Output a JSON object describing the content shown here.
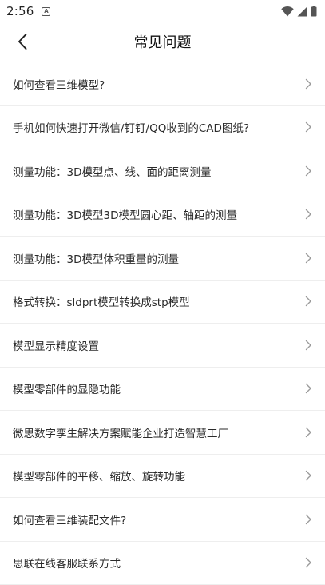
{
  "status_bar": {
    "time": "2:56",
    "notification_letter": "A",
    "icons": [
      "wifi-icon",
      "signal-icon",
      "battery-icon"
    ]
  },
  "header": {
    "title": "常见问题",
    "back_icon": "chevron-left-icon"
  },
  "faq": {
    "items": [
      {
        "label": "如何查看三维模型?"
      },
      {
        "label": "手机如何快速打开微信/钉钉/QQ收到的CAD图纸?"
      },
      {
        "label": "测量功能：3D模型点、线、面的距离测量"
      },
      {
        "label": "测量功能：3D模型3D模型圆心距、轴距的测量"
      },
      {
        "label": "测量功能：3D模型体积重量的测量"
      },
      {
        "label": "格式转换：sldprt模型转换成stp模型"
      },
      {
        "label": "模型显示精度设置"
      },
      {
        "label": "模型零部件的显隐功能"
      },
      {
        "label": "微思数字孪生解决方案赋能企业打造智慧工厂"
      },
      {
        "label": "模型零部件的平移、缩放、旋转功能"
      },
      {
        "label": "如何查看三维装配文件?"
      },
      {
        "label": "思联在线客服联系方式"
      }
    ]
  },
  "colors": {
    "divider": "#eeeeee",
    "chevron": "#9a9a9a",
    "text": "#2a2a2a"
  }
}
